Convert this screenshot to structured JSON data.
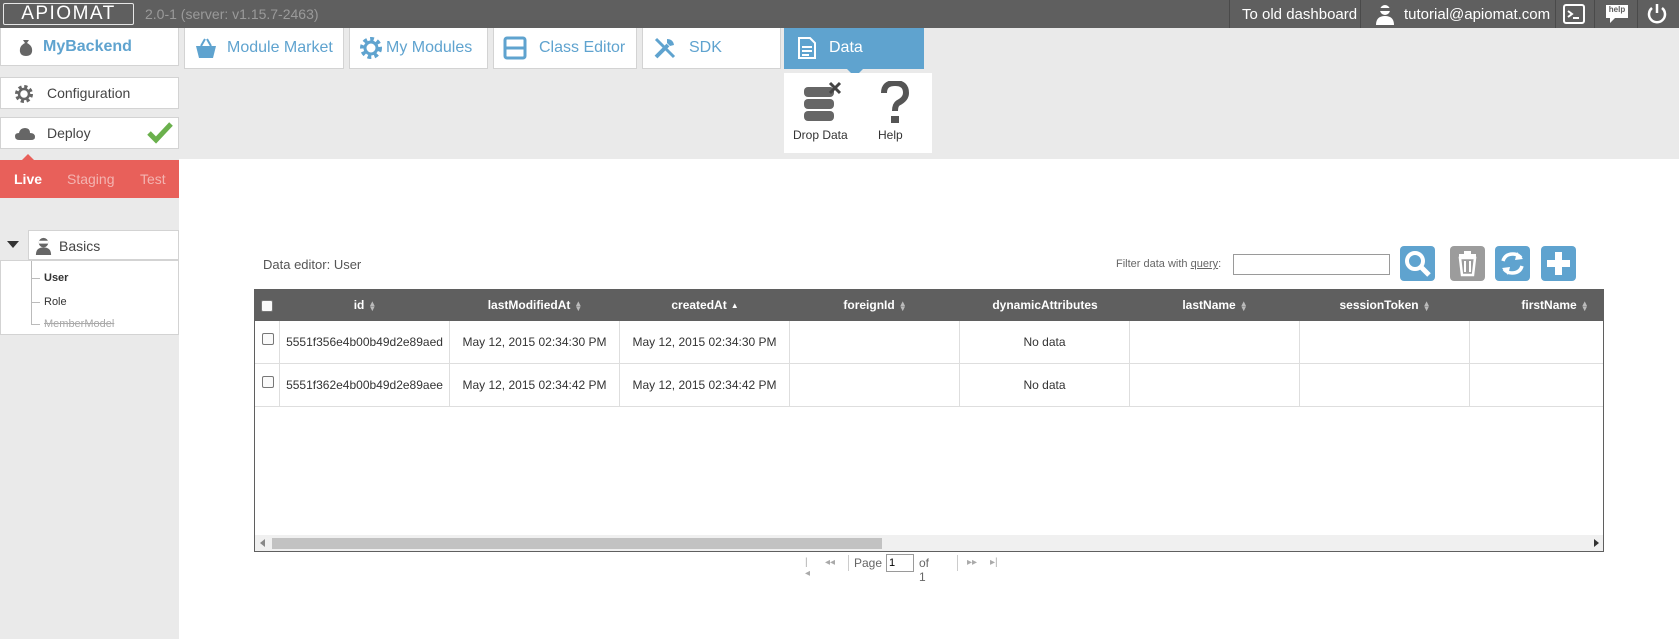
{
  "topbar": {
    "logo": "APIOMAT",
    "version": "2.0-1 (server: v1.15.7-2463)",
    "old_dashboard": "To old dashboard",
    "user_email": "tutorial@apiomat.com",
    "help_label": "help"
  },
  "sidebar": {
    "backend": "MyBackend",
    "configuration": "Configuration",
    "deploy": "Deploy",
    "environments": [
      "Live",
      "Staging",
      "Test"
    ],
    "tree": {
      "group": "Basics",
      "items": [
        "User",
        "Role",
        "MemberModel"
      ]
    }
  },
  "tabs": [
    {
      "label": "Module Market",
      "icon": "basket-icon"
    },
    {
      "label": "My Modules",
      "icon": "gear-icon"
    },
    {
      "label": "Class Editor",
      "icon": "class-editor-icon"
    },
    {
      "label": "SDK",
      "icon": "tools-icon"
    },
    {
      "label": "Data",
      "icon": "document-icon"
    }
  ],
  "data_panel": {
    "drop_data": "Drop Data",
    "help": "Help"
  },
  "editor": {
    "title": "Data editor: User",
    "filter_prefix": "Filter data with ",
    "filter_link": "query",
    "filter_suffix": ":",
    "filter_value": ""
  },
  "grid": {
    "columns": [
      "id",
      "lastModifiedAt",
      "createdAt",
      "foreignId",
      "dynamicAttributes",
      "lastName",
      "sessionToken",
      "firstName"
    ],
    "rows": [
      [
        "5551f356e4b00b49d2e89aed",
        "May 12, 2015 02:34:30 PM",
        "May 12, 2015 02:34:30 PM",
        "",
        "No data",
        "",
        "",
        ""
      ],
      [
        "5551f362e4b00b49d2e89aee",
        "May 12, 2015 02:34:42 PM",
        "May 12, 2015 02:34:42 PM",
        "",
        "No data",
        "",
        "",
        ""
      ]
    ]
  },
  "pager": {
    "page_label": "Page",
    "page_value": "1",
    "of_label": "of 1"
  },
  "colors": {
    "accent": "#5fa3cf",
    "env_bar": "#e8605a",
    "topbar": "#5f5f5f",
    "deploy_ok": "#6ab04c"
  }
}
